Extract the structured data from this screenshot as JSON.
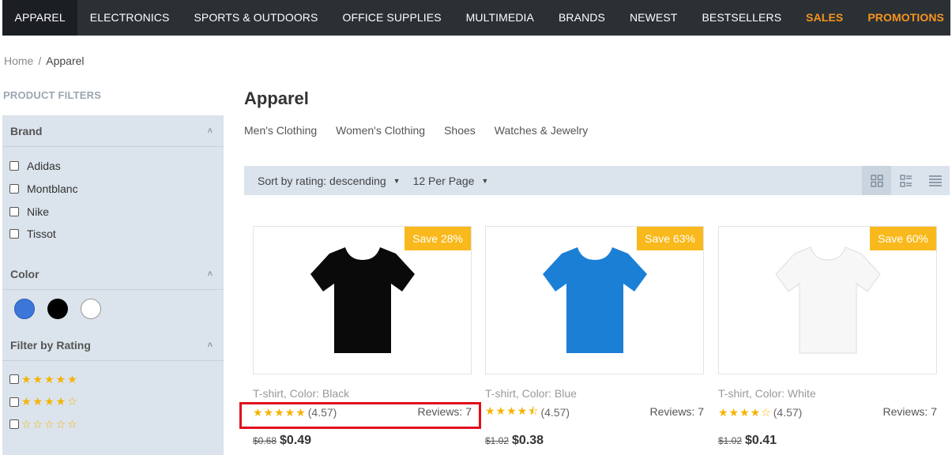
{
  "nav": {
    "items": [
      {
        "label": "APPAREL",
        "state": "active"
      },
      {
        "label": "ELECTRONICS",
        "state": ""
      },
      {
        "label": "SPORTS & OUTDOORS",
        "state": ""
      },
      {
        "label": "OFFICE SUPPLIES",
        "state": ""
      },
      {
        "label": "MULTIMEDIA",
        "state": ""
      },
      {
        "label": "BRANDS",
        "state": ""
      },
      {
        "label": "NEWEST",
        "state": ""
      },
      {
        "label": "BESTSELLERS",
        "state": ""
      },
      {
        "label": "SALES",
        "state": "accent"
      },
      {
        "label": "PROMOTIONS",
        "state": "accent"
      }
    ]
  },
  "breadcrumb": {
    "home": "Home",
    "separator": "/",
    "current": "Apparel"
  },
  "sidebar": {
    "title": "PRODUCT FILTERS",
    "brand": {
      "heading": "Brand",
      "options": [
        "Adidas",
        "Montblanc",
        "Nike",
        "Tissot"
      ]
    },
    "color": {
      "heading": "Color",
      "swatches": [
        "#3a77d9",
        "#000000",
        "#ffffff"
      ]
    },
    "rating": {
      "heading": "Filter by Rating",
      "options": [
        5,
        4,
        0
      ]
    }
  },
  "main": {
    "title": "Apparel",
    "subcategories": [
      "Men's Clothing",
      "Women's Clothing",
      "Shoes",
      "Watches & Jewelry"
    ],
    "sort_label": "Sort by rating: descending",
    "per_page_label": "12 Per Page"
  },
  "products": [
    {
      "badge": "Save 28%",
      "name": "T-shirt, Color: Black",
      "stars": "★★★★★",
      "rating": "(4.57)",
      "reviews": "Reviews: 7",
      "old_price": "$0.68",
      "price": "$0.49",
      "shirt_color": "#0a0a0a"
    },
    {
      "badge": "Save 63%",
      "name": "T-shirt, Color: Blue",
      "stars": "★★★★⯪",
      "rating": "(4.57)",
      "reviews": "Reviews: 7",
      "old_price": "$1.02",
      "price": "$0.38",
      "shirt_color": "#1b7fd6"
    },
    {
      "badge": "Save 60%",
      "name": "T-shirt, Color: White",
      "stars": "★★★★☆",
      "rating": "(4.57)",
      "reviews": "Reviews: 7",
      "old_price": "$1.02",
      "price": "$0.41",
      "shirt_color": "#f7f7f7"
    }
  ],
  "colors": {
    "accent": "#f7941d",
    "badge": "#f9b91c",
    "star": "#f5b301",
    "highlight": "#e0101d"
  },
  "icons": {
    "collapse": "chevron-up-icon",
    "dropdown": "caret-down-icon",
    "views": [
      "grid-view-icon",
      "list-grid-view-icon",
      "list-view-icon"
    ]
  }
}
